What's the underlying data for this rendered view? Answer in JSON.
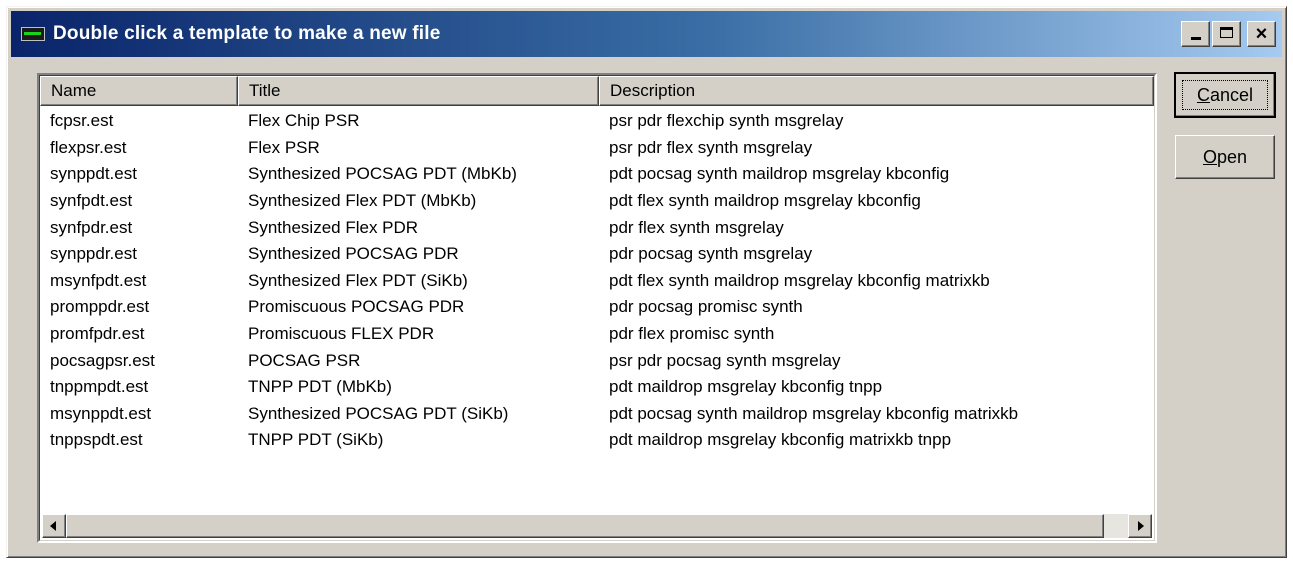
{
  "window": {
    "title": "Double click a template to make a new file",
    "caption_buttons": {
      "minimize": "minimize-icon",
      "maximize": "maximize-icon",
      "close": "×"
    }
  },
  "list": {
    "columns": [
      "Name",
      "Title",
      "Description"
    ],
    "rows": [
      [
        "fcpsr.est",
        "Flex Chip PSR",
        "psr pdr flexchip synth msgrelay"
      ],
      [
        "flexpsr.est",
        "Flex PSR",
        "psr pdr flex synth msgrelay"
      ],
      [
        "synppdt.est",
        "Synthesized POCSAG PDT (MbKb)",
        "pdt pocsag synth maildrop msgrelay kbconfig"
      ],
      [
        "synfpdt.est",
        "Synthesized Flex PDT (MbKb)",
        "pdt flex synth maildrop msgrelay kbconfig"
      ],
      [
        "synfpdr.est",
        "Synthesized Flex PDR",
        "pdr flex synth msgrelay"
      ],
      [
        "synppdr.est",
        "Synthesized POCSAG PDR",
        "pdr pocsag synth msgrelay"
      ],
      [
        "msynfpdt.est",
        "Synthesized Flex PDT (SiKb)",
        "pdt flex synth maildrop msgrelay kbconfig matrixkb"
      ],
      [
        "promppdr.est",
        "Promiscuous POCSAG PDR",
        "pdr pocsag promisc synth"
      ],
      [
        "promfpdr.est",
        "Promiscuous FLEX PDR",
        "pdr flex promisc synth"
      ],
      [
        "pocsagpsr.est",
        "POCSAG PSR",
        "psr pdr pocsag synth msgrelay"
      ],
      [
        "tnppmpdt.est",
        "TNPP PDT (MbKb)",
        "pdt maildrop msgrelay kbconfig tnpp"
      ],
      [
        "msynppdt.est",
        "Synthesized POCSAG PDT (SiKb)",
        "pdt pocsag synth maildrop msgrelay kbconfig matrixkb"
      ],
      [
        "tnppspdt.est",
        "TNPP PDT (SiKb)",
        "pdt maildrop msgrelay kbconfig matrixkb tnpp"
      ]
    ]
  },
  "buttons": {
    "cancel": {
      "accel": "C",
      "rest": "ancel"
    },
    "open": {
      "accel": "O",
      "rest": "pen"
    }
  },
  "icons": {
    "app": "terminal-icon",
    "scroll_left": "arrow-left-icon",
    "scroll_right": "arrow-right-icon"
  }
}
